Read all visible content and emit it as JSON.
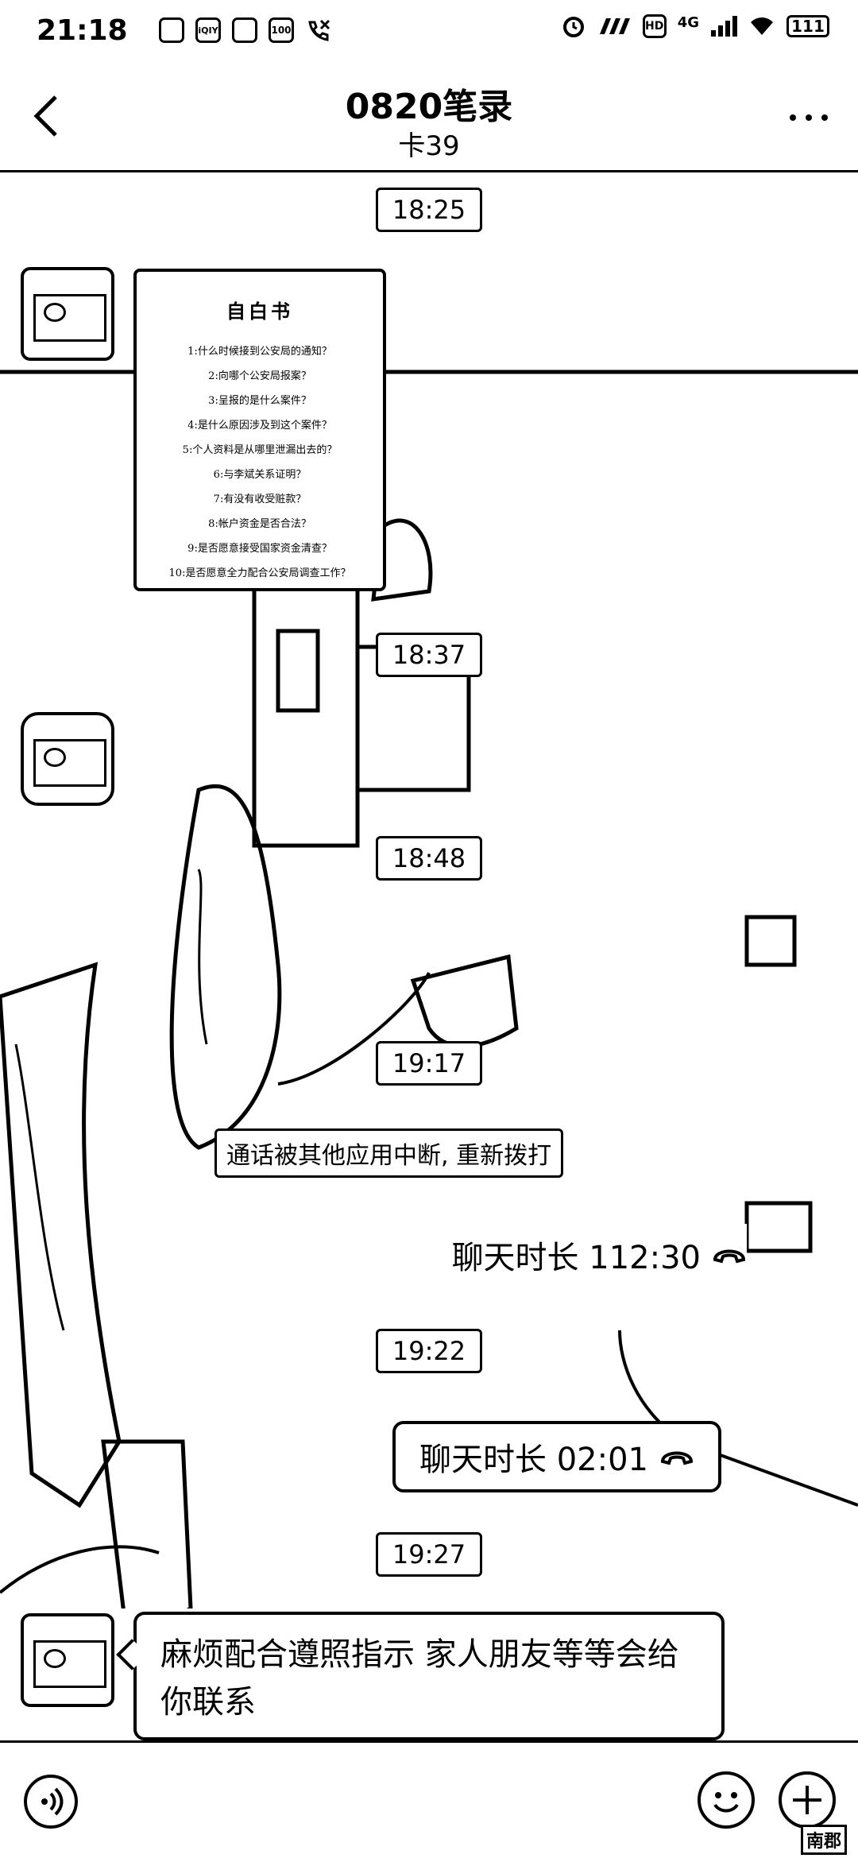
{
  "status_bar": {
    "time": "21:18",
    "left_icons": [
      "app-icon",
      "iqiyi-icon",
      "tiktok-icon",
      "note-icon",
      "missed-call-icon"
    ],
    "left_icon_labels": [
      "",
      "iQIY",
      "",
      "100",
      ""
    ],
    "network": "4G",
    "battery": "111"
  },
  "header": {
    "title": "0820笔录",
    "subtitle": "卡39"
  },
  "timestamps": [
    "18:25",
    "18:37",
    "18:48",
    "19:17",
    "19:22",
    "19:27"
  ],
  "document": {
    "title": "自白书",
    "items": [
      "1:什么时候接到公安局的通知？",
      "2:向哪个公安局报案？",
      "3:呈报的是什么案件？",
      "4:是什么原因涉及到这个案件？",
      "5:个人资料是从哪里泄漏出去的？",
      "6:与李斌关系证明？",
      "7:有没有收受赃款？",
      "8:帐户资金是否合法？",
      "9:是否愿意接受国家资金清查？",
      "10:是否愿意全力配合公安局调查工作？"
    ]
  },
  "system_notice": "通话被其他应用中断, 重新拨打",
  "calls": [
    {
      "label": "聊天时长 112:30"
    },
    {
      "label": "聊天时长 02:01"
    }
  ],
  "last_message": "麻烦配合遵照指示 家人朋友等等会给你联系",
  "watermark": "南郡",
  "colors": {
    "ink": "#000000",
    "paper": "#ffffff"
  }
}
